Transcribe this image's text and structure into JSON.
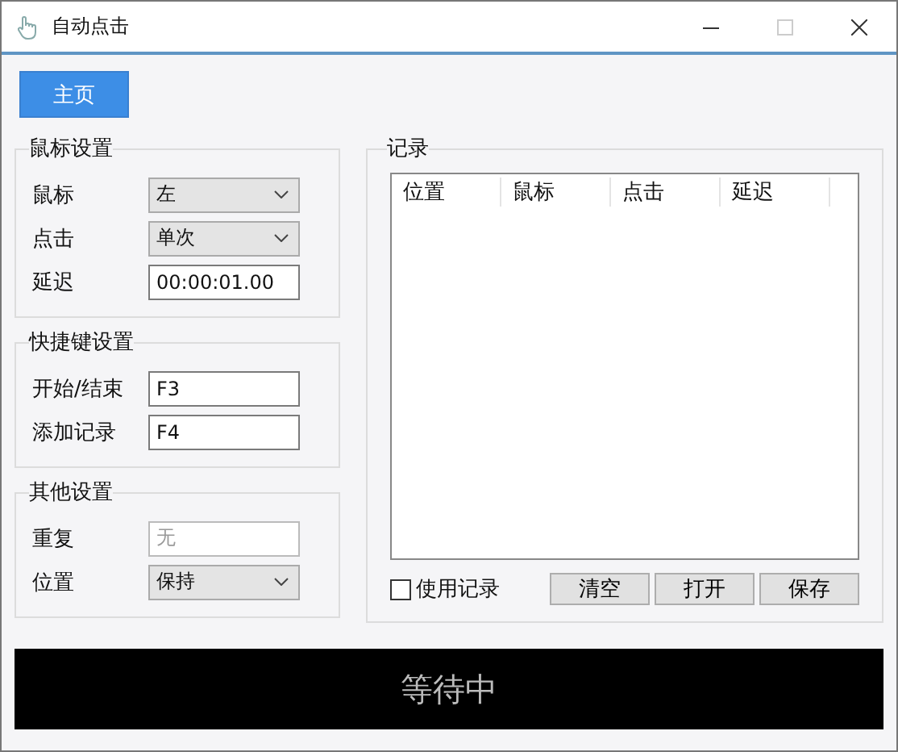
{
  "window": {
    "title": "自动点击"
  },
  "home_button": {
    "label": "主页"
  },
  "groups": [
    {
      "title": "鼠标设置",
      "fields": [
        {
          "label": "鼠标",
          "kind": "dropdown",
          "value": "左",
          "disabled": false
        },
        {
          "label": "点击",
          "kind": "dropdown",
          "value": "单次",
          "disabled": false
        },
        {
          "label": "延迟",
          "kind": "text",
          "value": "00:00:01.00",
          "disabled": false
        }
      ]
    },
    {
      "title": "快捷键设置",
      "fields": [
        {
          "label": "开始/结束",
          "kind": "text",
          "value": "F3",
          "disabled": false
        },
        {
          "label": "添加记录",
          "kind": "text",
          "value": "F4",
          "disabled": false
        }
      ]
    },
    {
      "title": "其他设置",
      "fields": [
        {
          "label": "重复",
          "kind": "text",
          "value": "无",
          "disabled": true
        },
        {
          "label": "位置",
          "kind": "dropdown",
          "value": "保持",
          "disabled": false
        }
      ]
    }
  ],
  "record": {
    "title": "记录",
    "columns": [
      "位置",
      "鼠标",
      "点击",
      "延迟"
    ],
    "use_record": {
      "label": "使用记录",
      "checked": false
    },
    "buttons": [
      "清空",
      "打开",
      "保存"
    ]
  },
  "status": {
    "text": "等待中"
  }
}
